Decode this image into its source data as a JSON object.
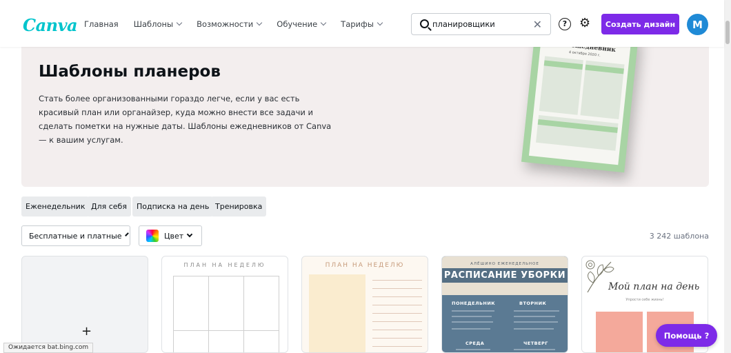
{
  "brand": {
    "logo": "Canva",
    "accent": "#7d2ae8",
    "logo_color": "#00c4cc"
  },
  "nav": {
    "items": [
      {
        "label": "Главная",
        "dropdown": false
      },
      {
        "label": "Шаблоны",
        "dropdown": true
      },
      {
        "label": "Возможности",
        "dropdown": true
      },
      {
        "label": "Обучение",
        "dropdown": true
      },
      {
        "label": "Тарифы",
        "dropdown": true
      }
    ]
  },
  "search": {
    "value": "планировщики",
    "icon": "search-icon",
    "clear_icon": "close-icon"
  },
  "header_actions": {
    "help_icon": "question-icon",
    "settings_icon": "gear-icon",
    "create_label": "Создать дизайн",
    "avatar_letter": "M"
  },
  "hero": {
    "title": "Шаблоны планеров",
    "description": "Стать более организованными гораздо легче, если у вас есть красивый план или органайзер, куда можно внести все задачи и сделать пометки на нужные даты. Шаблоны ежедневников от Canva — к вашим услугам.",
    "preview_title": "мой ежедневник",
    "preview_date": "4 октября 2020 г."
  },
  "chips": [
    "Еженедельник",
    "Для себя",
    "Подписка на день",
    "Тренировка"
  ],
  "filters": {
    "price_label": "Бесплатные и платные",
    "color_label": "Цвет",
    "count": "3 242 шаблона"
  },
  "cards": {
    "blank_plus": "+",
    "c2_title": "ПЛАН НА НЕДЕЛЮ",
    "c3_title": "ПЛАН НА НЕДЕЛЮ",
    "c4_sub": "АЛЁШИНО ЕЖЕНЕДЕЛЬНОЕ",
    "c4_title": "РАСПИСАНИЕ УБОРКИ",
    "c4_days": [
      "ПОНЕДЕЛЬНИК",
      "ВТОРНИК",
      "СРЕДА",
      "ЧЕТВЕРГ"
    ],
    "c5_title": "Мой план на день",
    "c5_sub": "Упрости себе жизнь!"
  },
  "help_button": "Помощь ?",
  "status_text": "Ожидается bat.bing.com"
}
